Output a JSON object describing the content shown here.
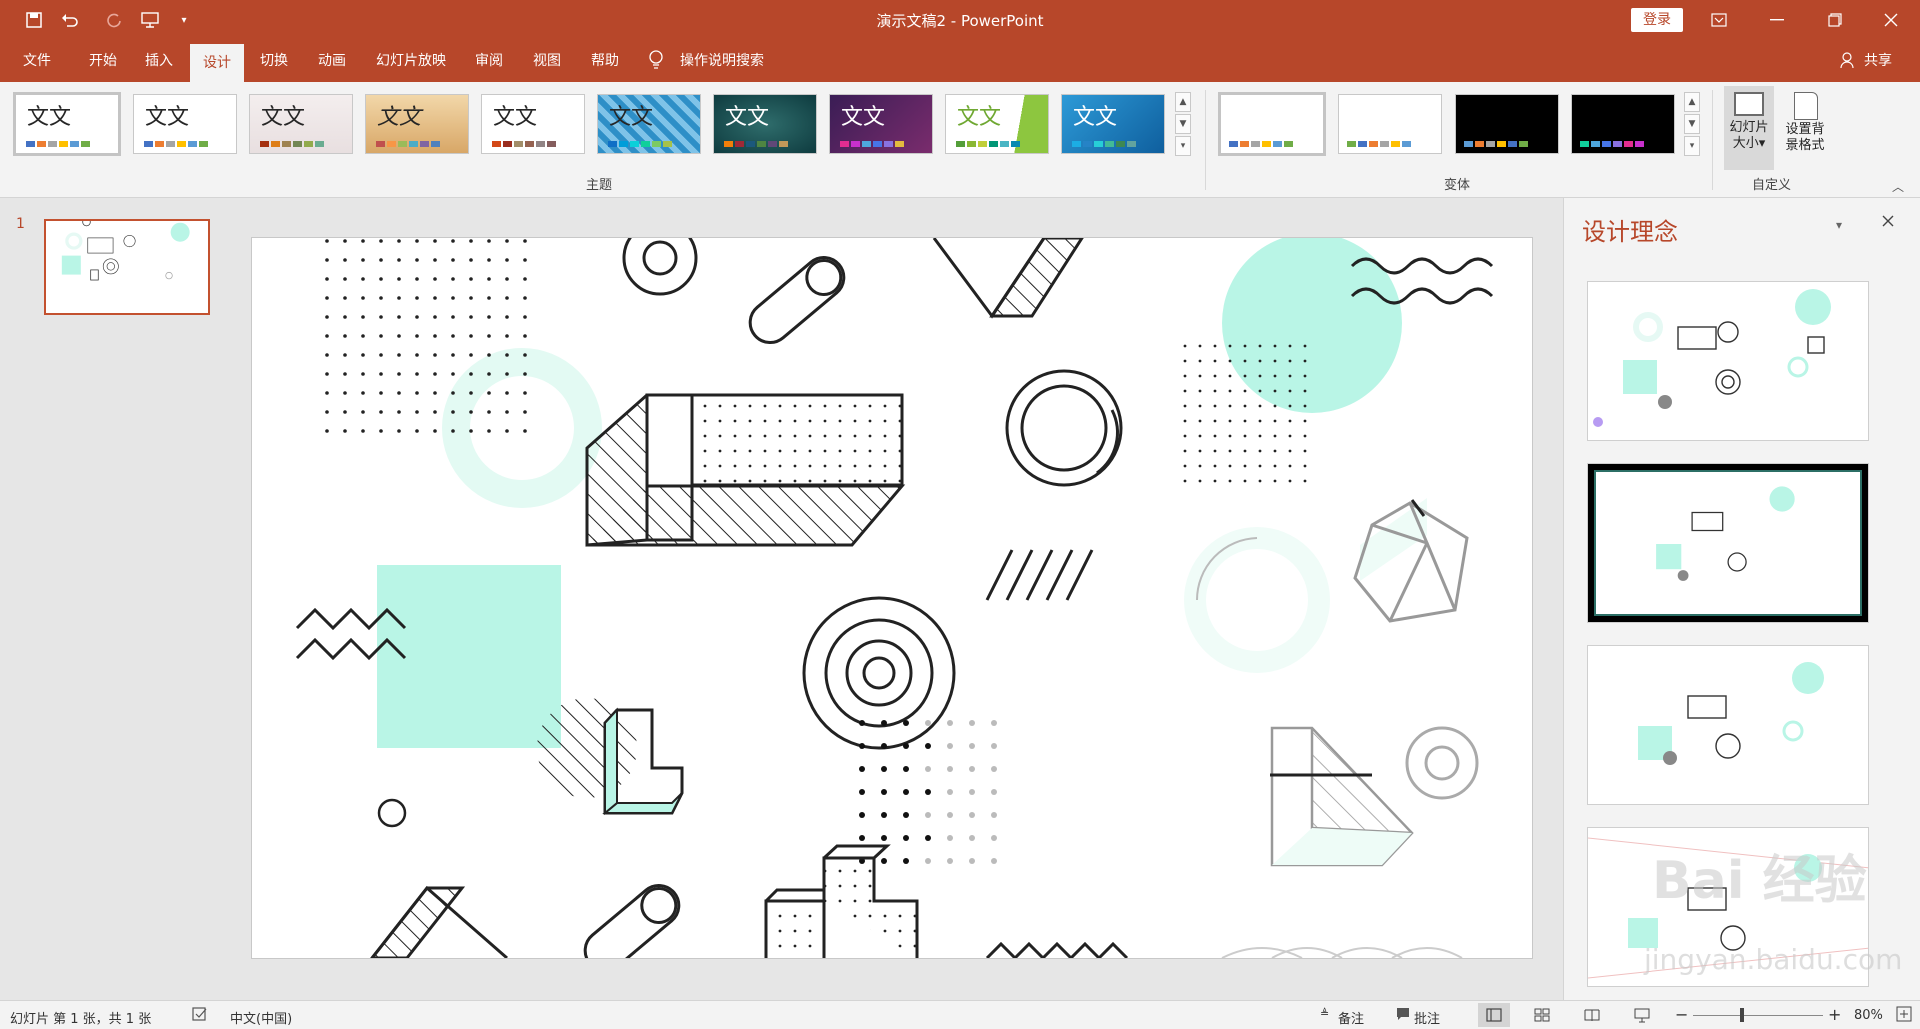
{
  "window": {
    "title": "演示文稿2  -  PowerPoint",
    "login_label": "登录",
    "share_label": "共享"
  },
  "tabs": [
    {
      "label": "文件"
    },
    {
      "label": "开始"
    },
    {
      "label": "插入"
    },
    {
      "label": "设计"
    },
    {
      "label": "切换"
    },
    {
      "label": "动画"
    },
    {
      "label": "幻灯片放映"
    },
    {
      "label": "审阅"
    },
    {
      "label": "视图"
    },
    {
      "label": "帮助"
    }
  ],
  "tell_me": "操作说明搜索",
  "ribbon": {
    "themes_group_label": "主题",
    "variants_group_label": "变体",
    "customize_group_label": "自定义",
    "theme_sample_text": "文文",
    "slide_size_label_1": "幻灯片",
    "slide_size_label_2": "大小",
    "format_bg_label_1": "设置背",
    "format_bg_label_2": "景格式"
  },
  "thumbnail": {
    "number": "1"
  },
  "design_ideas": {
    "title": "设计理念"
  },
  "statusbar": {
    "slide_info": "幻灯片 第 1 张，共 1 张",
    "language": "中文(中国)",
    "notes_label": "备注",
    "comments_label": "批注",
    "zoom": "80%"
  },
  "watermark": {
    "line1": "Bai 经验",
    "line2": "jingyan.baidu.com"
  },
  "colors": {
    "accent": "#b7472a",
    "mint": "#b9f5e6"
  }
}
